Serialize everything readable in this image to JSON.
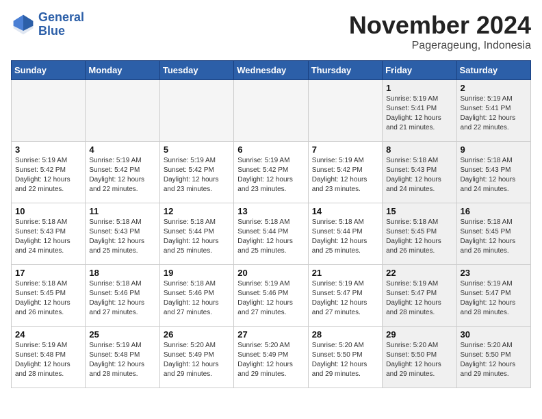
{
  "logo": {
    "line1": "General",
    "line2": "Blue"
  },
  "title": "November 2024",
  "subtitle": "Pagerageung, Indonesia",
  "days_header": [
    "Sunday",
    "Monday",
    "Tuesday",
    "Wednesday",
    "Thursday",
    "Friday",
    "Saturday"
  ],
  "weeks": [
    [
      {
        "day": "",
        "info": "",
        "empty": true
      },
      {
        "day": "",
        "info": "",
        "empty": true
      },
      {
        "day": "",
        "info": "",
        "empty": true
      },
      {
        "day": "",
        "info": "",
        "empty": true
      },
      {
        "day": "",
        "info": "",
        "empty": true
      },
      {
        "day": "1",
        "info": "Sunrise: 5:19 AM\nSunset: 5:41 PM\nDaylight: 12 hours\nand 21 minutes.",
        "shaded": true
      },
      {
        "day": "2",
        "info": "Sunrise: 5:19 AM\nSunset: 5:41 PM\nDaylight: 12 hours\nand 22 minutes.",
        "shaded": true
      }
    ],
    [
      {
        "day": "3",
        "info": "Sunrise: 5:19 AM\nSunset: 5:42 PM\nDaylight: 12 hours\nand 22 minutes."
      },
      {
        "day": "4",
        "info": "Sunrise: 5:19 AM\nSunset: 5:42 PM\nDaylight: 12 hours\nand 22 minutes."
      },
      {
        "day": "5",
        "info": "Sunrise: 5:19 AM\nSunset: 5:42 PM\nDaylight: 12 hours\nand 23 minutes."
      },
      {
        "day": "6",
        "info": "Sunrise: 5:19 AM\nSunset: 5:42 PM\nDaylight: 12 hours\nand 23 minutes."
      },
      {
        "day": "7",
        "info": "Sunrise: 5:19 AM\nSunset: 5:42 PM\nDaylight: 12 hours\nand 23 minutes."
      },
      {
        "day": "8",
        "info": "Sunrise: 5:18 AM\nSunset: 5:43 PM\nDaylight: 12 hours\nand 24 minutes.",
        "shaded": true
      },
      {
        "day": "9",
        "info": "Sunrise: 5:18 AM\nSunset: 5:43 PM\nDaylight: 12 hours\nand 24 minutes.",
        "shaded": true
      }
    ],
    [
      {
        "day": "10",
        "info": "Sunrise: 5:18 AM\nSunset: 5:43 PM\nDaylight: 12 hours\nand 24 minutes."
      },
      {
        "day": "11",
        "info": "Sunrise: 5:18 AM\nSunset: 5:43 PM\nDaylight: 12 hours\nand 25 minutes."
      },
      {
        "day": "12",
        "info": "Sunrise: 5:18 AM\nSunset: 5:44 PM\nDaylight: 12 hours\nand 25 minutes."
      },
      {
        "day": "13",
        "info": "Sunrise: 5:18 AM\nSunset: 5:44 PM\nDaylight: 12 hours\nand 25 minutes."
      },
      {
        "day": "14",
        "info": "Sunrise: 5:18 AM\nSunset: 5:44 PM\nDaylight: 12 hours\nand 25 minutes."
      },
      {
        "day": "15",
        "info": "Sunrise: 5:18 AM\nSunset: 5:45 PM\nDaylight: 12 hours\nand 26 minutes.",
        "shaded": true
      },
      {
        "day": "16",
        "info": "Sunrise: 5:18 AM\nSunset: 5:45 PM\nDaylight: 12 hours\nand 26 minutes.",
        "shaded": true
      }
    ],
    [
      {
        "day": "17",
        "info": "Sunrise: 5:18 AM\nSunset: 5:45 PM\nDaylight: 12 hours\nand 26 minutes."
      },
      {
        "day": "18",
        "info": "Sunrise: 5:18 AM\nSunset: 5:46 PM\nDaylight: 12 hours\nand 27 minutes."
      },
      {
        "day": "19",
        "info": "Sunrise: 5:18 AM\nSunset: 5:46 PM\nDaylight: 12 hours\nand 27 minutes."
      },
      {
        "day": "20",
        "info": "Sunrise: 5:19 AM\nSunset: 5:46 PM\nDaylight: 12 hours\nand 27 minutes."
      },
      {
        "day": "21",
        "info": "Sunrise: 5:19 AM\nSunset: 5:47 PM\nDaylight: 12 hours\nand 27 minutes."
      },
      {
        "day": "22",
        "info": "Sunrise: 5:19 AM\nSunset: 5:47 PM\nDaylight: 12 hours\nand 28 minutes.",
        "shaded": true
      },
      {
        "day": "23",
        "info": "Sunrise: 5:19 AM\nSunset: 5:47 PM\nDaylight: 12 hours\nand 28 minutes.",
        "shaded": true
      }
    ],
    [
      {
        "day": "24",
        "info": "Sunrise: 5:19 AM\nSunset: 5:48 PM\nDaylight: 12 hours\nand 28 minutes."
      },
      {
        "day": "25",
        "info": "Sunrise: 5:19 AM\nSunset: 5:48 PM\nDaylight: 12 hours\nand 28 minutes."
      },
      {
        "day": "26",
        "info": "Sunrise: 5:20 AM\nSunset: 5:49 PM\nDaylight: 12 hours\nand 29 minutes."
      },
      {
        "day": "27",
        "info": "Sunrise: 5:20 AM\nSunset: 5:49 PM\nDaylight: 12 hours\nand 29 minutes."
      },
      {
        "day": "28",
        "info": "Sunrise: 5:20 AM\nSunset: 5:50 PM\nDaylight: 12 hours\nand 29 minutes."
      },
      {
        "day": "29",
        "info": "Sunrise: 5:20 AM\nSunset: 5:50 PM\nDaylight: 12 hours\nand 29 minutes.",
        "shaded": true
      },
      {
        "day": "30",
        "info": "Sunrise: 5:20 AM\nSunset: 5:50 PM\nDaylight: 12 hours\nand 29 minutes.",
        "shaded": true
      }
    ]
  ]
}
